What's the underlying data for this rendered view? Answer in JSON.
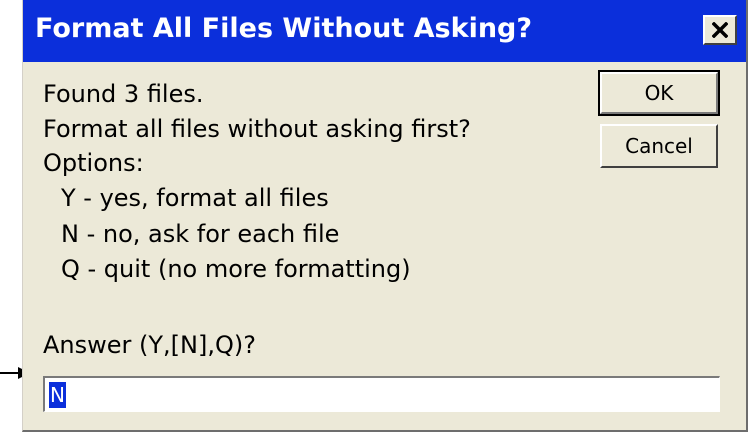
{
  "dialog": {
    "title": "Format All Files Without Asking?",
    "close_icon": "close-icon",
    "message": {
      "found": "Found 3 files.",
      "question": "Format all files without asking first?",
      "options_label": "Options:",
      "options": [
        "Y - yes, format all files",
        "N - no, ask for each file",
        "Q - quit (no more formatting)"
      ]
    },
    "prompt": "Answer (Y,[N],Q)?",
    "answer_value": "N",
    "buttons": {
      "ok": "OK",
      "cancel": "Cancel"
    }
  },
  "colors": {
    "titlebar": "#0b2fdb",
    "dialog_bg": "#ece9d8",
    "selection": "#0b2fdb"
  },
  "annotation": {
    "pointer_icon": "arrow-right-icon"
  }
}
